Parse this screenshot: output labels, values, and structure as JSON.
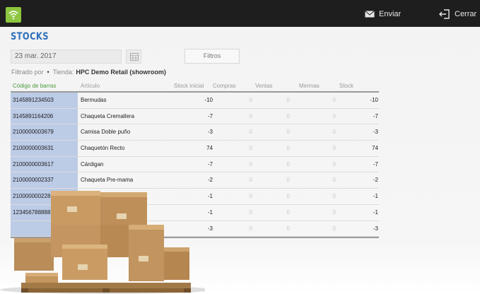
{
  "topbar": {
    "send_label": "Enviar",
    "close_label": "Cerrar",
    "icons": [
      "wifi-icon",
      "mail-icon",
      "exit-icon"
    ],
    "accent": "#8dc63f"
  },
  "page": {
    "title": "STOCKS"
  },
  "filters": {
    "date_value": "23 mar. 2017",
    "button_label": "Filtros",
    "filtered_by_label": "Filtrado por",
    "store_label": "Tienda:",
    "store_value": "HPC Demo Retail (showroom)"
  },
  "table": {
    "headers": {
      "barcode": "Código de barras",
      "article": "Artículo",
      "initial": "Stock inicial",
      "purchases": "Compras",
      "sales": "Ventas",
      "losses": "Mermas",
      "stock": "Stock"
    },
    "rows": [
      {
        "barcode": "3145891234503",
        "article": "Bermudas",
        "initial": "-10",
        "purchases": "0",
        "sales": "0",
        "losses": "0",
        "stock": "-10"
      },
      {
        "barcode": "3145891164206",
        "article": "Chaqueta Cremallera",
        "initial": "-7",
        "purchases": "0",
        "sales": "0",
        "losses": "0",
        "stock": "-7"
      },
      {
        "barcode": "2100000003679",
        "article": "Camisa Doble puño",
        "initial": "-3",
        "purchases": "0",
        "sales": "0",
        "losses": "0",
        "stock": "-3"
      },
      {
        "barcode": "2100000003631",
        "article": "Chaquetón Recto",
        "initial": "74",
        "purchases": "0",
        "sales": "0",
        "losses": "0",
        "stock": "74"
      },
      {
        "barcode": "2100000003617",
        "article": "Cárdigan",
        "initial": "-7",
        "purchases": "0",
        "sales": "0",
        "losses": "0",
        "stock": "-7"
      },
      {
        "barcode": "2100000002337",
        "article": "Chaqueta Pre-mama",
        "initial": "-2",
        "purchases": "0",
        "sales": "0",
        "losses": "0",
        "stock": "-2"
      },
      {
        "barcode": "210000000228",
        "article": "",
        "initial": "-1",
        "purchases": "0",
        "sales": "0",
        "losses": "0",
        "stock": "-1"
      },
      {
        "barcode": "123456788888",
        "article": "",
        "initial": "-1",
        "purchases": "0",
        "sales": "0",
        "losses": "0",
        "stock": "-1"
      },
      {
        "barcode": "",
        "article": "",
        "initial": "-3",
        "purchases": "0",
        "sales": "0",
        "losses": "0",
        "stock": "-3"
      }
    ]
  },
  "overlay": {
    "image": "cardboard-boxes-on-pallet"
  }
}
